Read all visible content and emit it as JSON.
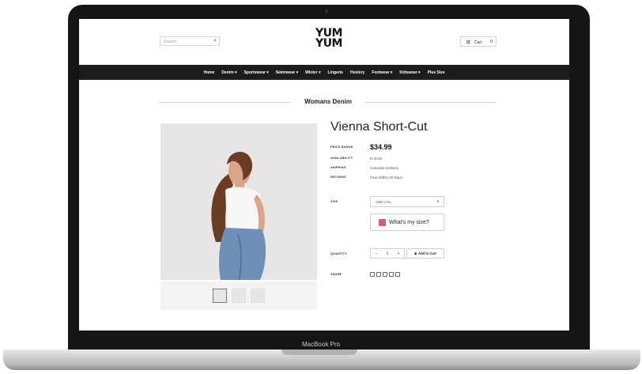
{
  "device": {
    "label": "MacBook Pro"
  },
  "header": {
    "search_placeholder": "Search",
    "logo_text_1": "YUM",
    "logo_text_2": "YUM",
    "cart_label": "Cart",
    "cart_count": "0"
  },
  "nav": {
    "items": [
      "Home",
      "Denim ▾",
      "Sportswear ▾",
      "Swimwear ▾",
      "Winter ▾",
      "Lingerie",
      "Hosiery",
      "Footwear ▾",
      "Kidswear ▾",
      "Plus Size"
    ]
  },
  "section": {
    "title": "Womans Denim"
  },
  "product": {
    "title": "Vienna Short-Cut",
    "price_label": "PRICE RANGE",
    "price": "$34.99",
    "availability_label": "AVAILABILITY",
    "availability": "In stock",
    "shipping_label": "SHIPPING",
    "shipping": "Calculate Delivery",
    "returns_label": "RETURNS",
    "returns": "Free Within 30 Days",
    "size_label": "SIZE",
    "size_selected": "10W-L/XL",
    "size_guide": "What's my size?",
    "quantity_label": "QUANTITY",
    "quantity": "1",
    "add_to_cart": "Add to Cart",
    "share_label": "SHARE"
  },
  "colors": {
    "nav_bg": "#1c1c1c",
    "size_guide_icon": "#e3566f"
  }
}
